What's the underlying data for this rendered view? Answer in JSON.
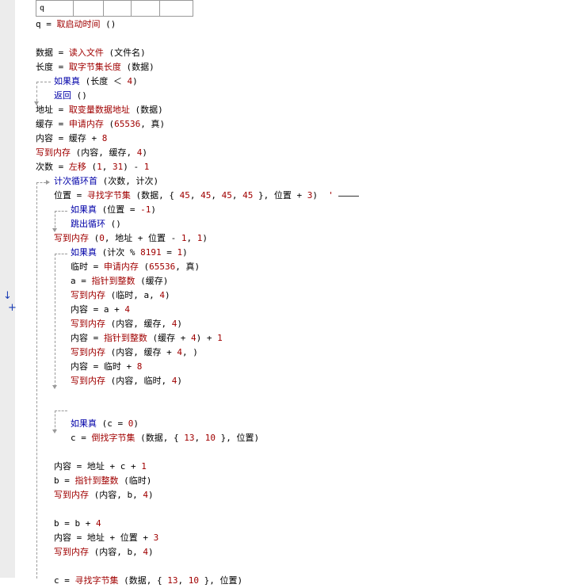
{
  "var_table": {
    "cells": [
      "q",
      "",
      "",
      "",
      ""
    ]
  },
  "gutter_marker": {
    "arrow": "↓",
    "plus": "+"
  },
  "lines": [
    {
      "indent": 0,
      "tokens": [
        [
          "txt",
          "q = "
        ],
        [
          "fn",
          "取启动时间"
        ],
        [
          "txt",
          " ()"
        ]
      ]
    },
    {
      "indent": 0,
      "tokens": []
    },
    {
      "indent": 0,
      "tokens": [
        [
          "txt",
          "数据 = "
        ],
        [
          "fn",
          "读入文件"
        ],
        [
          "txt",
          " (文件名)"
        ]
      ]
    },
    {
      "indent": 0,
      "tokens": [
        [
          "txt",
          "长度 = "
        ],
        [
          "fn",
          "取字节集长度"
        ],
        [
          "txt",
          " (数据)"
        ]
      ]
    },
    {
      "indent": 1,
      "tokens": [
        [
          "kw",
          "如果真"
        ],
        [
          "txt",
          " (长度 ＜ "
        ],
        [
          "num",
          "4"
        ],
        [
          "txt",
          ")"
        ]
      ]
    },
    {
      "indent": 1,
      "tokens": [
        [
          "kw",
          "返回"
        ],
        [
          "txt",
          " ()"
        ]
      ]
    },
    {
      "indent": 0,
      "tokens": [
        [
          "txt",
          "地址 = "
        ],
        [
          "fn",
          "取变量数据地址"
        ],
        [
          "txt",
          " (数据)"
        ]
      ]
    },
    {
      "indent": 0,
      "tokens": [
        [
          "txt",
          "缓存 = "
        ],
        [
          "fn",
          "申请内存"
        ],
        [
          "txt",
          " ("
        ],
        [
          "num",
          "65536"
        ],
        [
          "txt",
          ", 真)"
        ]
      ]
    },
    {
      "indent": 0,
      "tokens": [
        [
          "txt",
          "内容 = 缓存 + "
        ],
        [
          "num",
          "8"
        ]
      ]
    },
    {
      "indent": 0,
      "tokens": [
        [
          "fn",
          "写到内存"
        ],
        [
          "txt",
          " (内容, 缓存, "
        ],
        [
          "num",
          "4"
        ],
        [
          "txt",
          ")"
        ]
      ]
    },
    {
      "indent": 0,
      "tokens": [
        [
          "txt",
          "次数 = "
        ],
        [
          "fn",
          "左移"
        ],
        [
          "txt",
          " ("
        ],
        [
          "num",
          "1"
        ],
        [
          "txt",
          ", "
        ],
        [
          "num",
          "31"
        ],
        [
          "txt",
          ") - "
        ],
        [
          "num",
          "1"
        ]
      ]
    },
    {
      "indent": 1,
      "tokens": [
        [
          "kw",
          "计次循环首"
        ],
        [
          "txt",
          " (次数, 计次)"
        ]
      ]
    },
    {
      "indent": 1,
      "tokens": [
        [
          "txt",
          "位置 = "
        ],
        [
          "fn",
          "寻找字节集"
        ],
        [
          "txt",
          " (数据, { "
        ],
        [
          "num",
          "45"
        ],
        [
          "txt",
          ", "
        ],
        [
          "num",
          "45"
        ],
        [
          "txt",
          ", "
        ],
        [
          "num",
          "45"
        ],
        [
          "txt",
          ", "
        ],
        [
          "num",
          "45"
        ],
        [
          "txt",
          " }, 位置 + "
        ],
        [
          "num",
          "3"
        ],
        [
          "txt",
          ")  "
        ],
        [
          "cmt",
          "'"
        ]
      ]
    },
    {
      "indent": 2,
      "tokens": [
        [
          "kw",
          "如果真"
        ],
        [
          "txt",
          " (位置 = "
        ],
        [
          "num",
          "-1"
        ],
        [
          "txt",
          ")"
        ]
      ]
    },
    {
      "indent": 2,
      "tokens": [
        [
          "kw",
          "跳出循环"
        ],
        [
          "txt",
          " ()"
        ]
      ]
    },
    {
      "indent": 1,
      "tokens": [
        [
          "fn",
          "写到内存"
        ],
        [
          "txt",
          " ("
        ],
        [
          "num",
          "0"
        ],
        [
          "txt",
          ", 地址 + 位置 - "
        ],
        [
          "num",
          "1"
        ],
        [
          "txt",
          ", "
        ],
        [
          "num",
          "1"
        ],
        [
          "txt",
          ")"
        ]
      ]
    },
    {
      "indent": 2,
      "tokens": [
        [
          "kw",
          "如果真"
        ],
        [
          "txt",
          " (计次 % "
        ],
        [
          "num",
          "8191"
        ],
        [
          "txt",
          " = "
        ],
        [
          "num",
          "1"
        ],
        [
          "txt",
          ")"
        ]
      ]
    },
    {
      "indent": 2,
      "tokens": [
        [
          "txt",
          "临时 = "
        ],
        [
          "fn",
          "申请内存"
        ],
        [
          "txt",
          " ("
        ],
        [
          "num",
          "65536"
        ],
        [
          "txt",
          ", 真)"
        ]
      ]
    },
    {
      "indent": 2,
      "tokens": [
        [
          "txt",
          "a = "
        ],
        [
          "fn",
          "指针到整数"
        ],
        [
          "txt",
          " (缓存)"
        ]
      ]
    },
    {
      "indent": 2,
      "tokens": [
        [
          "fn",
          "写到内存"
        ],
        [
          "txt",
          " (临时, a, "
        ],
        [
          "num",
          "4"
        ],
        [
          "txt",
          ")"
        ]
      ]
    },
    {
      "indent": 2,
      "tokens": [
        [
          "txt",
          "内容 = a + "
        ],
        [
          "num",
          "4"
        ]
      ]
    },
    {
      "indent": 2,
      "tokens": [
        [
          "fn",
          "写到内存"
        ],
        [
          "txt",
          " (内容, 缓存, "
        ],
        [
          "num",
          "4"
        ],
        [
          "txt",
          ")"
        ]
      ]
    },
    {
      "indent": 2,
      "tokens": [
        [
          "txt",
          "内容 = "
        ],
        [
          "fn",
          "指针到整数"
        ],
        [
          "txt",
          " (缓存 + "
        ],
        [
          "num",
          "4"
        ],
        [
          "txt",
          ") + "
        ],
        [
          "num",
          "1"
        ]
      ]
    },
    {
      "indent": 2,
      "tokens": [
        [
          "fn",
          "写到内存"
        ],
        [
          "txt",
          " (内容, 缓存 + "
        ],
        [
          "num",
          "4"
        ],
        [
          "txt",
          ", )"
        ]
      ]
    },
    {
      "indent": 2,
      "tokens": [
        [
          "txt",
          "内容 = 临时 + "
        ],
        [
          "num",
          "8"
        ]
      ]
    },
    {
      "indent": 2,
      "tokens": [
        [
          "fn",
          "写到内存"
        ],
        [
          "txt",
          " (内容, 临时, "
        ],
        [
          "num",
          "4"
        ],
        [
          "txt",
          ")"
        ]
      ]
    },
    {
      "indent": 2,
      "tokens": []
    },
    {
      "indent": 2,
      "tokens": []
    },
    {
      "indent": 2,
      "tokens": [
        [
          "kw",
          "如果真"
        ],
        [
          "txt",
          " (c = "
        ],
        [
          "num",
          "0"
        ],
        [
          "txt",
          ")"
        ]
      ]
    },
    {
      "indent": 2,
      "tokens": [
        [
          "txt",
          "c = "
        ],
        [
          "fn",
          "倒找字节集"
        ],
        [
          "txt",
          " (数据, { "
        ],
        [
          "num",
          "13"
        ],
        [
          "txt",
          ", "
        ],
        [
          "num",
          "10"
        ],
        [
          "txt",
          " }, 位置)"
        ]
      ]
    },
    {
      "indent": 1,
      "tokens": []
    },
    {
      "indent": 1,
      "tokens": [
        [
          "txt",
          "内容 = 地址 + c + "
        ],
        [
          "num",
          "1"
        ]
      ]
    },
    {
      "indent": 1,
      "tokens": [
        [
          "txt",
          "b = "
        ],
        [
          "fn",
          "指针到整数"
        ],
        [
          "txt",
          " (临时)"
        ]
      ]
    },
    {
      "indent": 1,
      "tokens": [
        [
          "fn",
          "写到内存"
        ],
        [
          "txt",
          " (内容, b, "
        ],
        [
          "num",
          "4"
        ],
        [
          "txt",
          ")"
        ]
      ]
    },
    {
      "indent": 1,
      "tokens": []
    },
    {
      "indent": 1,
      "tokens": [
        [
          "txt",
          "b = b + "
        ],
        [
          "num",
          "4"
        ]
      ]
    },
    {
      "indent": 1,
      "tokens": [
        [
          "txt",
          "内容 = 地址 + 位置 + "
        ],
        [
          "num",
          "3"
        ]
      ]
    },
    {
      "indent": 1,
      "tokens": [
        [
          "fn",
          "写到内存"
        ],
        [
          "txt",
          " (内容, b, "
        ],
        [
          "num",
          "4"
        ],
        [
          "txt",
          ")"
        ]
      ]
    },
    {
      "indent": 1,
      "tokens": []
    },
    {
      "indent": 1,
      "tokens": [
        [
          "txt",
          "c = "
        ],
        [
          "fn",
          "寻找字节集"
        ],
        [
          "txt",
          " (数据, { "
        ],
        [
          "num",
          "13"
        ],
        [
          "txt",
          ", "
        ],
        [
          "num",
          "10"
        ],
        [
          "txt",
          " }, 位置)"
        ]
      ]
    }
  ]
}
